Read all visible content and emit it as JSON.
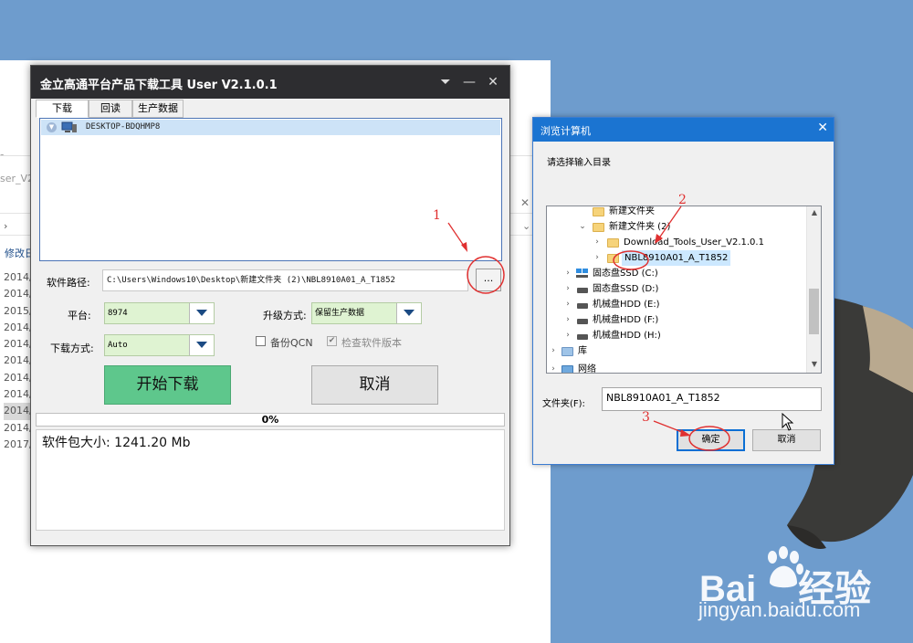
{
  "background": {
    "explorer_title_fragment": "ser_V2.",
    "modified_header": "修改日",
    "dates": [
      "2014/",
      "2014/",
      "2015/",
      "2014/",
      "2014/",
      "2014/",
      "2014/",
      "2014/",
      "2014/",
      "2014/",
      "2017/"
    ]
  },
  "main_window": {
    "title": "金立高通平台产品下载工具 User V2.1.0.1",
    "tabs": [
      "下载",
      "回读",
      "生产数据"
    ],
    "device": "DESKTOP-BDQHMP8",
    "software_path_label": "软件路径:",
    "software_path": "C:\\Users\\Windows10\\Desktop\\新建文件夹 (2)\\NBL8910A01_A_T1852",
    "browse_label": "...",
    "platform_label": "平台:",
    "platform_value": "8974",
    "upgrade_label": "升级方式:",
    "upgrade_value": "保留生产数据",
    "download_mode_label": "下载方式:",
    "download_mode_value": "Auto",
    "backup_qcn_label": "备份QCN",
    "backup_qcn_checked": false,
    "check_version_label": "检查软件版本",
    "check_version_checked": true,
    "start_button": "开始下载",
    "cancel_button": "取消",
    "progress_percent": 0,
    "progress_text": "0%",
    "log_text": "软件包大小: 1241.20 Mb"
  },
  "browse_dialog": {
    "title": "浏览计算机",
    "prompt": "请选择输入目录",
    "tree": [
      {
        "label": "新建文件夹",
        "type": "folder",
        "expander": ""
      },
      {
        "label": "新建文件夹 (2)",
        "type": "folder",
        "expander": "⌄"
      },
      {
        "label": "Download_Tools_User_V2.1.0.1",
        "type": "folder",
        "expander": "›"
      },
      {
        "label": "NBL8910A01_A_T1852",
        "type": "folder",
        "expander": "›",
        "selected": true
      },
      {
        "label": "固态盘SSD (C:)",
        "type": "drive",
        "expander": "›"
      },
      {
        "label": "固态盘SSD (D:)",
        "type": "drive",
        "expander": "›"
      },
      {
        "label": "机械盘HDD (E:)",
        "type": "drive",
        "expander": "›"
      },
      {
        "label": "机械盘HDD (F:)",
        "type": "drive",
        "expander": "›"
      },
      {
        "label": "机械盘HDD (H:)",
        "type": "drive",
        "expander": "›"
      },
      {
        "label": "库",
        "type": "library",
        "expander": "›"
      },
      {
        "label": "网络",
        "type": "network",
        "expander": "›"
      }
    ],
    "folder_label": "文件夹(F):",
    "folder_value": "NBL8910A01_A_T1852",
    "ok_button": "确定",
    "cancel_button": "取消"
  },
  "annotations": {
    "step1": "1",
    "step2": "2",
    "step3": "3",
    "color": "#e03030"
  },
  "watermark": {
    "logo_left": "Bai",
    "logo_right": "经验",
    "url": "jingyan.baidu.com"
  }
}
